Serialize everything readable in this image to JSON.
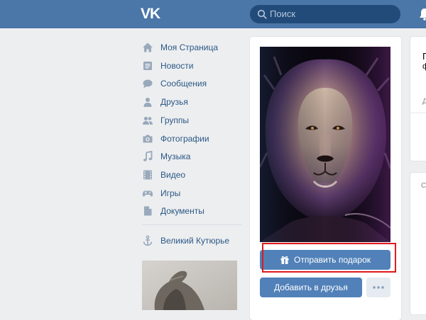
{
  "header": {
    "logo_text": "VK",
    "search_placeholder": "Поиск",
    "bar_color": "#4a76a8",
    "search_color": "#224b7a"
  },
  "menu": {
    "items": [
      {
        "label": "Моя Страница",
        "icon": "home-icon"
      },
      {
        "label": "Новости",
        "icon": "news-icon"
      },
      {
        "label": "Сообщения",
        "icon": "messages-icon"
      },
      {
        "label": "Друзья",
        "icon": "friends-icon"
      },
      {
        "label": "Группы",
        "icon": "groups-icon"
      },
      {
        "label": "Фотографии",
        "icon": "photos-icon"
      },
      {
        "label": "Музыка",
        "icon": "music-icon"
      },
      {
        "label": "Видео",
        "icon": "video-icon"
      },
      {
        "label": "Игры",
        "icon": "games-icon"
      },
      {
        "label": "Документы",
        "icon": "documents-icon"
      }
    ],
    "extra_item": {
      "label": "Великий Кутюрье",
      "icon": "anchor-icon"
    },
    "link_color": "#2a5885",
    "icon_color": "#99a9bb"
  },
  "profile": {
    "send_gift_label": "Отправить подарок",
    "add_friend_label": "Добавить в друзья",
    "more_label": "•••",
    "button_color": "#5181b8",
    "highlight_color": "#e0191b",
    "photo_subject": "lion"
  },
  "side": {
    "title_fragment": "Г",
    "subtitle_fragment": "ф",
    "meta_fragment": "Д",
    "card2_fragment": "С"
  }
}
